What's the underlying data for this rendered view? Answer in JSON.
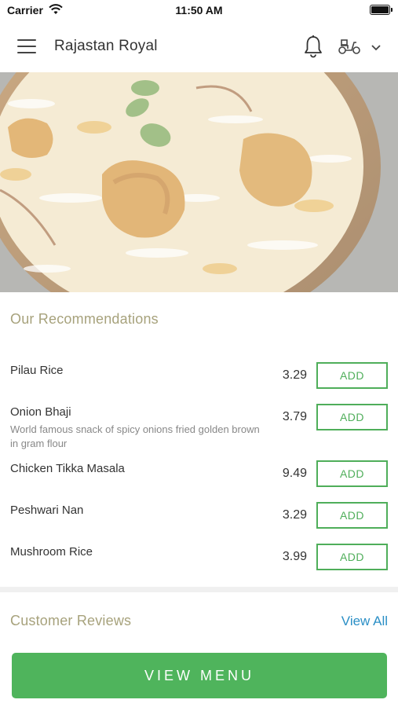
{
  "status_bar": {
    "carrier": "Carrier",
    "time": "11:50 AM"
  },
  "nav": {
    "title": "Rajastan Royal"
  },
  "recommendations": {
    "title": "Our Recommendations",
    "items": [
      {
        "name": "Pilau Rice",
        "description": "",
        "price": "3.29",
        "add_label": "ADD"
      },
      {
        "name": "Onion Bhaji",
        "description": "World famous snack of spicy onions fried golden brown in gram flour",
        "price": "3.79",
        "add_label": "ADD"
      },
      {
        "name": "Chicken Tikka Masala",
        "description": "",
        "price": "9.49",
        "add_label": "ADD"
      },
      {
        "name": "Peshwari Nan",
        "description": "",
        "price": "3.29",
        "add_label": "ADD"
      },
      {
        "name": "Mushroom Rice",
        "description": "",
        "price": "3.99",
        "add_label": "ADD"
      }
    ]
  },
  "reviews": {
    "title": "Customer Reviews",
    "view_all": "View All"
  },
  "footer": {
    "view_menu_label": "VIEW MENU"
  },
  "colors": {
    "accent_green": "#4fb45c",
    "section_title": "#a7a27c",
    "link_blue": "#2b8fc6"
  }
}
